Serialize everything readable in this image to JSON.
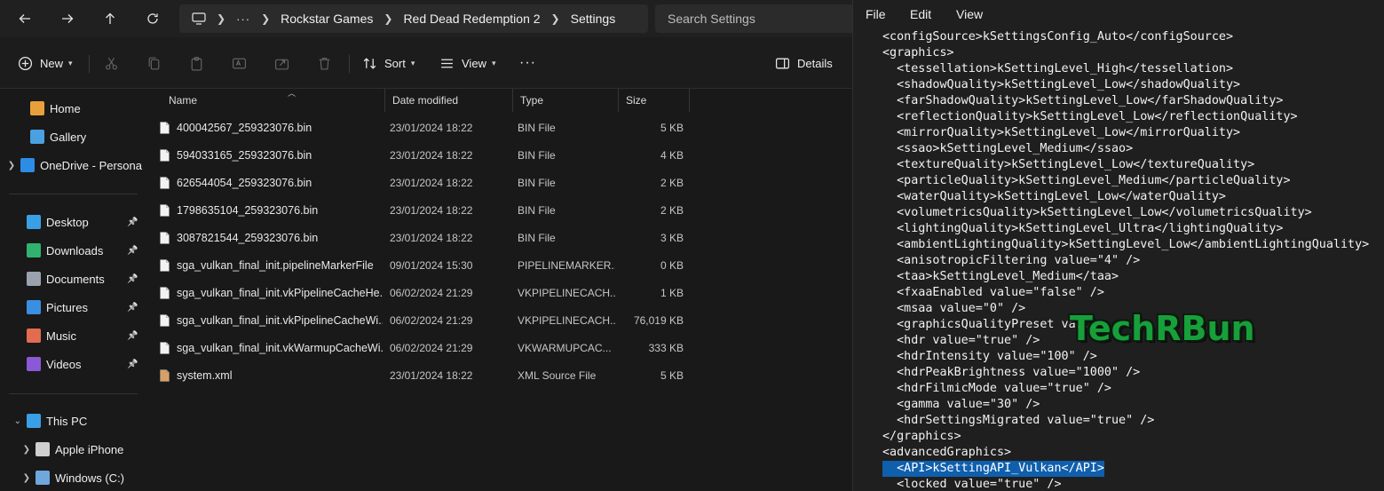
{
  "explorer": {
    "search": {
      "placeholder": "Search Settings"
    },
    "breadcrumb": [
      "Rockstar Games",
      "Red Dead Redemption 2",
      "Settings"
    ],
    "breadcrumb_more": "···",
    "toolbar": {
      "new_label": "New",
      "sort_label": "Sort",
      "view_label": "View",
      "more_label": "···",
      "details_label": "Details"
    },
    "sidebar": {
      "items": [
        {
          "label": "Home",
          "icon": "home-icon",
          "color": "#e8a13a"
        },
        {
          "label": "Gallery",
          "icon": "gallery-icon",
          "color": "#4aa0e0"
        },
        {
          "label": "OneDrive - Persona",
          "icon": "cloud-icon",
          "color": "#2d8ce6"
        },
        {
          "label": "Desktop",
          "icon": "desktop-icon",
          "color": "#3aa0e6"
        },
        {
          "label": "Downloads",
          "icon": "download-icon",
          "color": "#2fb36f"
        },
        {
          "label": "Documents",
          "icon": "document-icon",
          "color": "#9aa3ad"
        },
        {
          "label": "Pictures",
          "icon": "pictures-icon",
          "color": "#3b8fe0"
        },
        {
          "label": "Music",
          "icon": "music-icon",
          "color": "#e36b4f"
        },
        {
          "label": "Videos",
          "icon": "videos-icon",
          "color": "#8b59d6"
        },
        {
          "label": "This PC",
          "icon": "pc-icon",
          "color": "#3aa0e6"
        },
        {
          "label": "Apple iPhone",
          "icon": "phone-icon",
          "color": "#cfcfcf"
        },
        {
          "label": "Windows (C:)",
          "icon": "drive-icon",
          "color": "#6fa8dc"
        }
      ]
    },
    "columns": {
      "name": "Name",
      "date": "Date modified",
      "type": "Type",
      "size": "Size"
    },
    "files": [
      {
        "name": "400042567_259323076.bin",
        "date": "23/01/2024 18:22",
        "type": "BIN File",
        "size": "5 KB"
      },
      {
        "name": "594033165_259323076.bin",
        "date": "23/01/2024 18:22",
        "type": "BIN File",
        "size": "4 KB"
      },
      {
        "name": "626544054_259323076.bin",
        "date": "23/01/2024 18:22",
        "type": "BIN File",
        "size": "2 KB"
      },
      {
        "name": "1798635104_259323076.bin",
        "date": "23/01/2024 18:22",
        "type": "BIN File",
        "size": "2 KB"
      },
      {
        "name": "3087821544_259323076.bin",
        "date": "23/01/2024 18:22",
        "type": "BIN File",
        "size": "3 KB"
      },
      {
        "name": "sga_vulkan_final_init.pipelineMarkerFile",
        "date": "09/01/2024 15:30",
        "type": "PIPELINEMARKER...",
        "size": "0 KB"
      },
      {
        "name": "sga_vulkan_final_init.vkPipelineCacheHe...",
        "date": "06/02/2024 21:29",
        "type": "VKPIPELINECACH...",
        "size": "1 KB"
      },
      {
        "name": "sga_vulkan_final_init.vkPipelineCacheWi...",
        "date": "06/02/2024 21:29",
        "type": "VKPIPELINECACH...",
        "size": "76,019 KB"
      },
      {
        "name": "sga_vulkan_final_init.vkWarmupCacheWi...",
        "date": "06/02/2024 21:29",
        "type": "VKWARMUPCAC...",
        "size": "333 KB"
      },
      {
        "name": "system.xml",
        "date": "23/01/2024 18:22",
        "type": "XML Source File",
        "size": "5 KB"
      }
    ]
  },
  "notepad": {
    "menu": [
      "File",
      "Edit",
      "View"
    ],
    "lines": [
      "<configSource>kSettingsConfig_Auto</configSource>",
      "<graphics>",
      "  <tessellation>kSettingLevel_High</tessellation>",
      "  <shadowQuality>kSettingLevel_Low</shadowQuality>",
      "  <farShadowQuality>kSettingLevel_Low</farShadowQuality>",
      "  <reflectionQuality>kSettingLevel_Low</reflectionQuality>",
      "  <mirrorQuality>kSettingLevel_Low</mirrorQuality>",
      "  <ssao>kSettingLevel_Medium</ssao>",
      "  <textureQuality>kSettingLevel_Low</textureQuality>",
      "  <particleQuality>kSettingLevel_Medium</particleQuality>",
      "  <waterQuality>kSettingLevel_Low</waterQuality>",
      "  <volumetricsQuality>kSettingLevel_Low</volumetricsQuality>",
      "  <lightingQuality>kSettingLevel_Ultra</lightingQuality>",
      "  <ambientLightingQuality>kSettingLevel_Low</ambientLightingQuality>",
      "  <anisotropicFiltering value=\"4\" />",
      "  <taa>kSettingLevel_Medium</taa>",
      "  <fxaaEnabled value=\"false\" />",
      "  <msaa value=\"0\" />",
      "  <graphicsQualityPreset va...",
      "  <hdr value=\"true\" />",
      "  <hdrIntensity value=\"100\" />",
      "  <hdrPeakBrightness value=\"1000\" />",
      "  <hdrFilmicMode value=\"true\" />",
      "  <gamma value=\"30\" />",
      "  <hdrSettingsMigrated value=\"true\" />",
      "</graphics>",
      "<advancedGraphics>",
      "  <API>kSettingAPI_Vulkan</API>",
      "  <locked value=\"true\" />"
    ],
    "selected_line_index": 27
  },
  "watermark": "TechRBun",
  "colors": {
    "selection": "#0f5fad",
    "watermark": "#17a63c"
  }
}
